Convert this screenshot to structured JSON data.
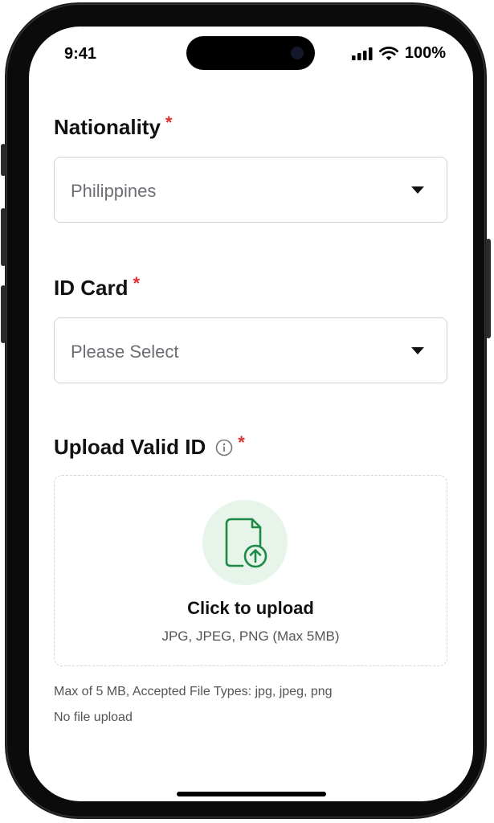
{
  "status_bar": {
    "time": "9:41",
    "battery": "100%",
    "icons": [
      "signal-icon",
      "wifi-icon"
    ]
  },
  "form": {
    "nationality": {
      "label": "Nationality",
      "required_mark": "*",
      "selected_value": "Philippines"
    },
    "id_card": {
      "label": "ID Card",
      "required_mark": "*",
      "placeholder": "Please Select"
    },
    "upload": {
      "label": "Upload Valid ID",
      "required_mark": "*",
      "info_icon": "info-icon",
      "upload_icon": "file-upload-icon",
      "title": "Click to upload",
      "subtitle": "JPG, JPEG, PNG (Max 5MB)",
      "helper_text": "Max of 5 MB, Accepted File Types: jpg, jpeg, png",
      "status_text": "No file upload"
    }
  },
  "colors": {
    "accent_green": "#1e8a45",
    "accent_green_bg": "#e6f4ea",
    "required_red": "#e03131"
  }
}
